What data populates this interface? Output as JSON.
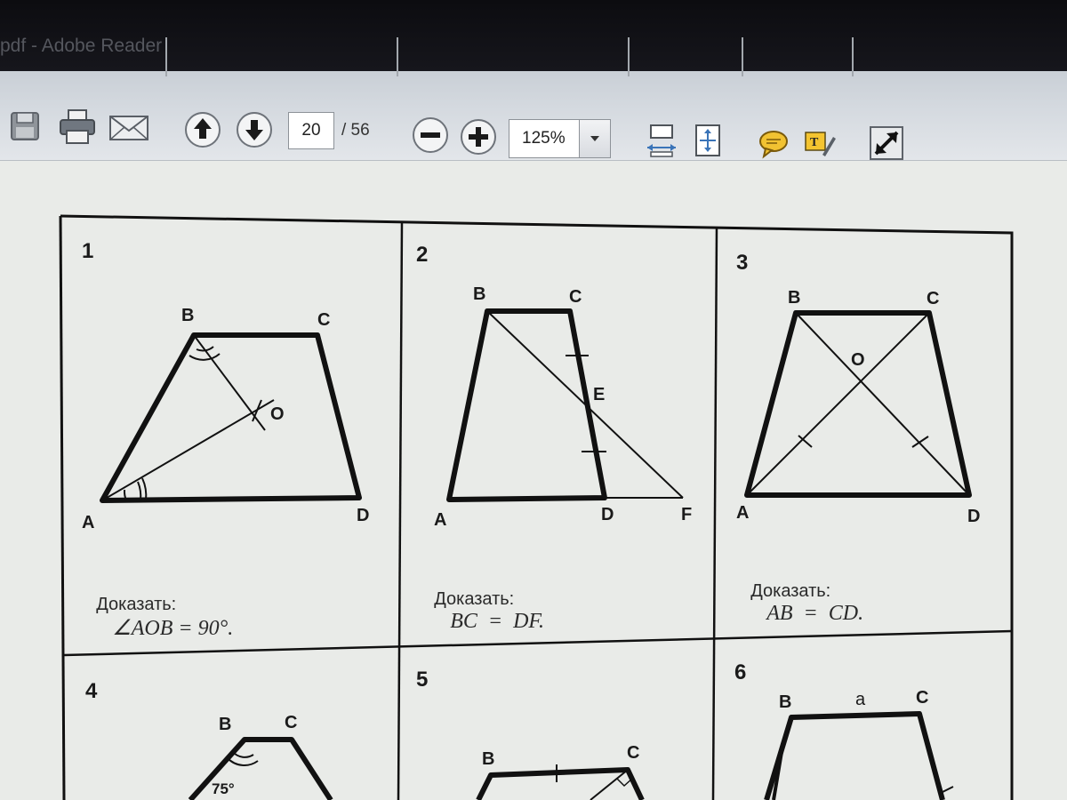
{
  "window": {
    "title": "pdf - Adobe Reader"
  },
  "toolbar": {
    "icons": [
      "save-icon",
      "print-icon",
      "email-icon",
      "previous-page-icon",
      "next-page-icon",
      "zoom-out-icon",
      "zoom-in-icon",
      "fit-width-icon",
      "fit-page-icon",
      "comment-icon",
      "sign-icon",
      "expand-icon"
    ],
    "page_current": "20",
    "page_total": "/ 56",
    "zoom": "125%"
  },
  "problems": [
    {
      "number": "1",
      "labels": {
        "a": "A",
        "b": "B",
        "c": "C",
        "d": "D",
        "o": "O"
      },
      "caption_prefix": "Доказать:",
      "caption_formula": "∠AOB = 90°."
    },
    {
      "number": "2",
      "labels": {
        "a": "A",
        "b": "B",
        "c": "C",
        "d": "D",
        "e": "E",
        "f": "F"
      },
      "caption_prefix": "Доказать:",
      "caption_formula": "BC  =  DF."
    },
    {
      "number": "3",
      "labels": {
        "a": "A",
        "b": "B",
        "c": "C",
        "d": "D",
        "o": "O"
      },
      "caption_prefix": "Доказать:",
      "caption_formula": "AB  =  CD."
    },
    {
      "number": "4",
      "labels": {
        "b": "B",
        "c": "C",
        "angle": "75°"
      }
    },
    {
      "number": "5",
      "labels": {
        "b": "B",
        "c": "C"
      }
    },
    {
      "number": "6",
      "labels": {
        "b": "B",
        "c": "C",
        "a_side": "a"
      }
    }
  ]
}
